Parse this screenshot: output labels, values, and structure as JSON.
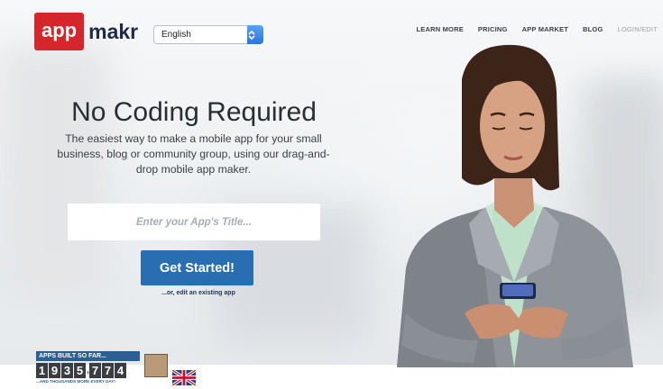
{
  "brand": {
    "part1": "app",
    "part2": "makr"
  },
  "language": {
    "selected": "English"
  },
  "nav": {
    "items": [
      {
        "label": "LEARN MORE"
      },
      {
        "label": "PRICING"
      },
      {
        "label": "APP MARKET"
      },
      {
        "label": "BLOG"
      }
    ],
    "login": "LOGIN/EDIT"
  },
  "hero": {
    "headline": "No Coding Required",
    "subtext": "The easiest way to make a mobile app for your small business, blog or community group, using our drag-and-drop mobile app maker.",
    "input_placeholder": "Enter your App's Title...",
    "cta_label": "Get Started!",
    "edit_link": "...or, edit an existing app"
  },
  "counter": {
    "title": "APPS BUILT SO FAR...",
    "digits": [
      "1",
      "9",
      "3",
      "5",
      ",",
      "7",
      "7",
      "4"
    ],
    "footer": "...AND THOUSANDS MORE EVERY DAY!"
  },
  "colors": {
    "brand_red": "#d5262b",
    "brand_navy": "#1f2a44",
    "cta_blue": "#2a6eb2",
    "counter_blue": "#2c5f94"
  },
  "icons": {
    "language_select": "chevron-updown-icon",
    "flag": "uk-flag-icon"
  }
}
